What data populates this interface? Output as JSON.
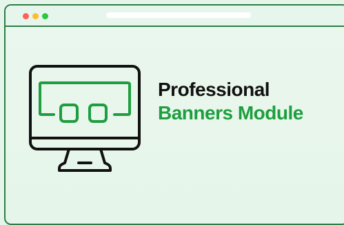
{
  "colors": {
    "accent_green": "#1e9e3e",
    "frame_green": "#2d7d46",
    "dark": "#111111",
    "dot_red": "#ff5f57",
    "dot_yellow": "#febc2e",
    "dot_green": "#28c840"
  },
  "browser": {
    "window_dots": [
      "red",
      "yellow",
      "green"
    ],
    "address_bar": ""
  },
  "icon": {
    "name": "desktop-monitor-icon"
  },
  "headline": {
    "line1": "Professional",
    "line2": "Banners Module"
  }
}
